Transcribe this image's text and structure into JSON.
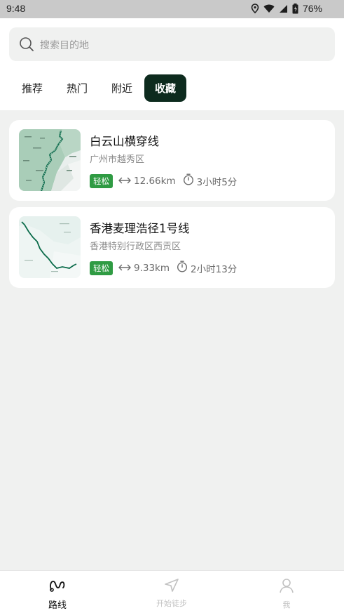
{
  "status_bar": {
    "time": "9:48",
    "battery": "76%"
  },
  "search": {
    "placeholder": "搜索目的地"
  },
  "tabs": [
    {
      "label": "推荐",
      "active": false
    },
    {
      "label": "热门",
      "active": false
    },
    {
      "label": "附近",
      "active": false
    },
    {
      "label": "收藏",
      "active": true
    }
  ],
  "routes": [
    {
      "title": "白云山横穿线",
      "location": "广州市越秀区",
      "difficulty": "轻松",
      "distance": "12.66km",
      "duration": "3小时5分"
    },
    {
      "title": "香港麦理浩径1号线",
      "location": "香港特别行政区西贡区",
      "difficulty": "轻松",
      "distance": "9.33km",
      "duration": "2小时13分"
    }
  ],
  "bottom_nav": [
    {
      "label": "路线",
      "icon": "route-icon",
      "active": true
    },
    {
      "label": "开始徒步",
      "icon": "navigation-arrow-icon",
      "active": false
    },
    {
      "label": "我",
      "icon": "person-icon",
      "active": false
    }
  ],
  "colors": {
    "accent_dark": "#0d2b1e",
    "badge_green": "#2f9b43",
    "route_line": "#0b6b4a"
  }
}
